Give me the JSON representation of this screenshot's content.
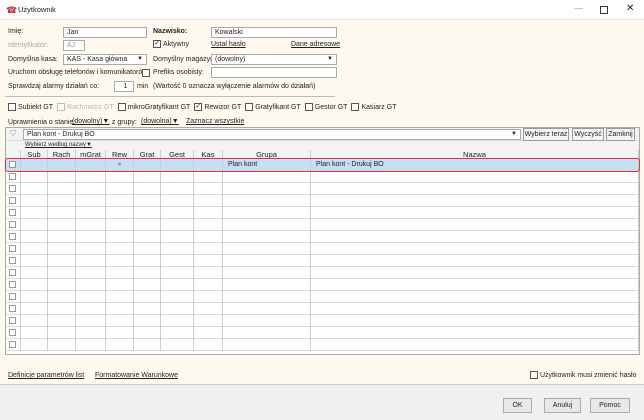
{
  "window": {
    "title": "Użytkownik",
    "icon": "user-group-icon"
  },
  "form": {
    "first_name_label": "Imię:",
    "first_name": "Jan",
    "last_name_label": "Nazwisko:",
    "last_name": "Kowalski",
    "id_label": "Identyfikator:",
    "id_value": "AJ",
    "active_label": "Aktywny",
    "active_checked": true,
    "set_password_link": "Ustal hasło",
    "address_link": "Dane adresowe",
    "cash_label": "Domyślna kasa:",
    "cash_value": "KAS - Kasa główna",
    "warehouse_label": "Domyślny magazyn:",
    "warehouse_value": "(dowolny)",
    "phone_label": "Uruchom obsługę telefonów i komunikatorów",
    "phone_checked": false,
    "prefix_label": "Prefiks osobisty:",
    "prefix_value": "",
    "alarm_label": "Sprawdzaj alarmy działań co:",
    "alarm_value": "1",
    "alarm_unit": "min",
    "alarm_note": "(Wartość 0 oznacza wyłączenie alarmów do działań)"
  },
  "modules": [
    {
      "label": "Subiekt GT",
      "checked": false,
      "disabled": false
    },
    {
      "label": "Rachmistrz GT",
      "checked": false,
      "disabled": true
    },
    {
      "label": "mikroGratyfikant GT",
      "checked": false,
      "disabled": false
    },
    {
      "label": "Rewizor GT",
      "checked": true,
      "disabled": false
    },
    {
      "label": "Gratyfikant GT",
      "checked": false,
      "disabled": false
    },
    {
      "label": "Gestor GT",
      "checked": false,
      "disabled": false
    },
    {
      "label": "Kasiarz GT",
      "checked": false,
      "disabled": false
    }
  ],
  "permissions": {
    "state_label": "Uprawnienia o stanie:",
    "state_value": "(dowolny)",
    "group_label": ", z grupy:",
    "group_value": "(dowolna)",
    "select_all": "Zaznacz wszystkie"
  },
  "filter": {
    "value": "Plan kont - Drukuj BO",
    "choose_now": "Wybierz teraz",
    "clear": "Wyczyść",
    "close": "Zamknij",
    "by_name": "Wybierz według nazwy"
  },
  "grid": {
    "columns": [
      "",
      "Sub",
      "Rach",
      "mGrat",
      "Rew",
      "Grat",
      "Gest",
      "Kas",
      "Grupa",
      "Nazwa"
    ],
    "rows": [
      {
        "checked": false,
        "rew": "●",
        "grupa": "Plan kont",
        "nazwa": "Plan kont - Drukuj BO",
        "selected": true
      }
    ],
    "empty_rows": 15,
    "selection_color": "#c5dff5",
    "selection_border": "#e03040"
  },
  "links": {
    "definitions": "Definicje parametrów list",
    "formatting": "Formatowanie Warunkowe"
  },
  "must_change_password": {
    "label": "Użytkownik musi zmienić hasło",
    "checked": false
  },
  "buttons": {
    "ok": "OK",
    "cancel": "Anuluj",
    "help": "Pomoc"
  }
}
